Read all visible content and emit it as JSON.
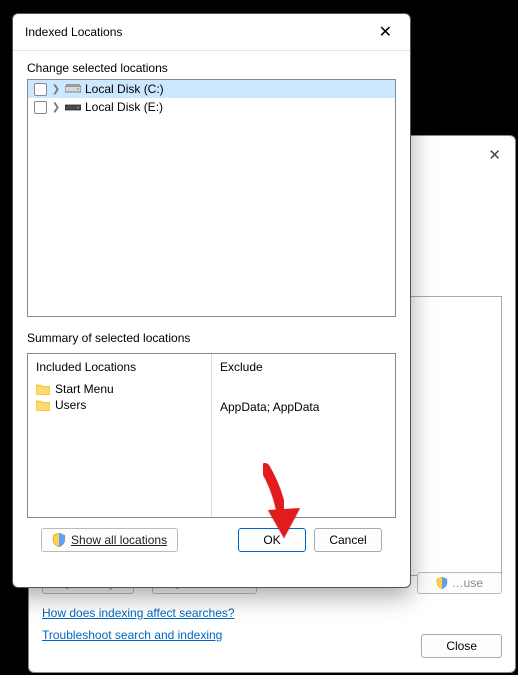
{
  "dialog": {
    "title": "Indexed Locations",
    "change_label": "Change selected locations",
    "tree": [
      {
        "label": "Local Disk (C:)",
        "selected": true,
        "icon": "drive-c"
      },
      {
        "label": "Local Disk (E:)",
        "selected": false,
        "icon": "drive-e"
      }
    ],
    "summary_label": "Summary of selected locations",
    "included_header": "Included Locations",
    "exclude_header": "Exclude",
    "included": [
      "Start Menu",
      "Users"
    ],
    "exclude_text": "AppData; AppData",
    "show_all": "Show all locations",
    "ok": "OK",
    "cancel": "Cancel"
  },
  "background": {
    "btn1": "…",
    "btn2": "…",
    "btn3": "…",
    "link1": "How does indexing affect searches?",
    "link2": "Troubleshoot search and indexing",
    "close": "Close"
  }
}
